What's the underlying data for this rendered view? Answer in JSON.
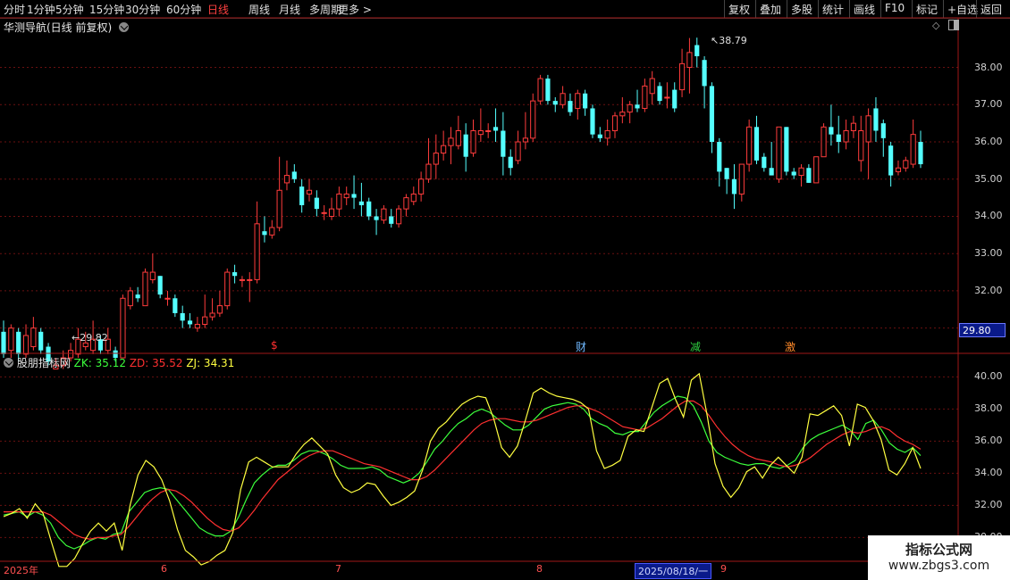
{
  "toolbar": {
    "periods": [
      "分时",
      "1分钟",
      "5分钟",
      "15分钟",
      "30分钟",
      "60分钟",
      "日线",
      "周线",
      "月线",
      "多周期",
      "更多 >"
    ],
    "active_period": "日线",
    "right_buttons": [
      "复权",
      "叠加",
      "多股",
      "统计",
      "画线",
      "F10",
      "标记",
      "+自选",
      "返回"
    ]
  },
  "main_panel": {
    "title": "华测导航(日线 前复权)",
    "max_label": "38.79",
    "min_label": "29.82",
    "current_price": "29.80",
    "y_ticks": [
      "38.00",
      "37.00",
      "36.00",
      "35.00",
      "34.00",
      "33.00",
      "32.00",
      "31.00"
    ],
    "events": [
      {
        "label": "$",
        "color": "#ff3030"
      },
      {
        "label": "财",
        "color": "#6fb8ff"
      },
      {
        "label": "减",
        "color": "#2fd040"
      },
      {
        "label": "激",
        "color": "#ff8a2a"
      }
    ]
  },
  "indicator_panel": {
    "name": "股朋指标网",
    "zk_label": "ZK: 35.12",
    "zd_label": "ZD: 35.52",
    "zj_label": "ZJ: 34.31",
    "y_ticks": [
      "40.00",
      "38.00",
      "36.00",
      "34.00",
      "32.00",
      "30.00"
    ]
  },
  "date_axis": {
    "labels": [
      "2025年",
      "6",
      "7",
      "8",
      "2025/08/18/一",
      "9"
    ]
  },
  "watermark": {
    "line1": "指标公式网",
    "line2": "www.zbgs3.com"
  },
  "colors": {
    "up": "#ff3c3c",
    "down": "#54ffff",
    "zk": "#3cff3c",
    "zd": "#ff3030",
    "zj": "#ffff40",
    "grid": "#6a1010",
    "border": "#a01818"
  },
  "chart_data": [
    {
      "type": "candlestick",
      "title": "华测导航(日线 前复权)",
      "y_axis_ticks": [
        31,
        32,
        33,
        34,
        35,
        36,
        37,
        38
      ],
      "ylim": [
        30.8,
        38.9
      ],
      "annotations": {
        "high": 38.79,
        "low": 29.82
      },
      "candles": [
        [
          30.9,
          30.3,
          31.2,
          30.2
        ],
        [
          30.4,
          31.0,
          31.1,
          30.2
        ],
        [
          30.9,
          30.3,
          31.0,
          30.1
        ],
        [
          30.3,
          30.8,
          31.1,
          30.2
        ],
        [
          30.5,
          31.0,
          31.3,
          30.4
        ],
        [
          30.9,
          30.4,
          31.0,
          30.3
        ],
        [
          30.5,
          30.1,
          30.6,
          30.0
        ],
        [
          29.9,
          30.0,
          30.2,
          29.9
        ],
        [
          30.0,
          30.2,
          30.4,
          29.9
        ],
        [
          30.2,
          30.4,
          30.6,
          30.1
        ],
        [
          30.3,
          30.7,
          31.0,
          30.2
        ],
        [
          30.5,
          30.6,
          30.9,
          30.4
        ],
        [
          30.4,
          30.7,
          31.2,
          30.3
        ],
        [
          30.7,
          30.4,
          30.8,
          30.3
        ],
        [
          30.4,
          30.7,
          31.0,
          30.3
        ],
        [
          30.4,
          30.2,
          30.5,
          30.1
        ],
        [
          30.2,
          31.8,
          31.9,
          30.2
        ],
        [
          31.6,
          32.0,
          32.1,
          31.5
        ],
        [
          31.9,
          31.8,
          32.1,
          31.7
        ],
        [
          31.6,
          32.5,
          32.6,
          31.6
        ],
        [
          32.3,
          32.5,
          33.0,
          32.2
        ],
        [
          32.4,
          31.9,
          32.4,
          31.8
        ],
        [
          31.8,
          31.8,
          32.0,
          31.6
        ],
        [
          31.8,
          31.4,
          31.9,
          31.3
        ],
        [
          31.4,
          31.2,
          31.6,
          31.0
        ],
        [
          31.2,
          31.1,
          31.4,
          31.0
        ],
        [
          31.0,
          31.1,
          31.3,
          30.9
        ],
        [
          31.1,
          31.3,
          31.9,
          31.0
        ],
        [
          31.3,
          31.4,
          31.8,
          31.2
        ],
        [
          31.4,
          31.6,
          32.0,
          31.3
        ],
        [
          31.6,
          32.5,
          32.6,
          31.5
        ],
        [
          32.5,
          32.4,
          32.7,
          32.2
        ],
        [
          32.3,
          32.3,
          32.4,
          32.1
        ],
        [
          32.3,
          32.3,
          32.5,
          31.7
        ],
        [
          32.3,
          33.8,
          34.4,
          32.2
        ],
        [
          33.6,
          33.5,
          34.0,
          33.3
        ],
        [
          33.5,
          33.7,
          33.9,
          33.4
        ],
        [
          33.7,
          34.7,
          35.6,
          33.6
        ],
        [
          34.9,
          35.1,
          35.5,
          34.7
        ],
        [
          35.2,
          35.0,
          35.4,
          34.9
        ],
        [
          34.8,
          34.3,
          35.0,
          34.1
        ],
        [
          34.6,
          34.7,
          35.0,
          34.4
        ],
        [
          34.5,
          34.2,
          34.7,
          34.0
        ],
        [
          34.1,
          34.1,
          34.3,
          33.9
        ],
        [
          34.0,
          34.2,
          34.5,
          33.9
        ],
        [
          34.2,
          34.6,
          34.8,
          34.0
        ],
        [
          34.5,
          34.6,
          34.8,
          34.3
        ],
        [
          34.6,
          34.5,
          35.1,
          34.2
        ],
        [
          34.4,
          34.3,
          34.9,
          34.0
        ],
        [
          34.4,
          34.0,
          34.5,
          33.9
        ],
        [
          34.0,
          33.9,
          34.2,
          33.5
        ],
        [
          33.9,
          34.2,
          34.3,
          33.8
        ],
        [
          34.0,
          33.8,
          34.2,
          33.7
        ],
        [
          33.8,
          34.2,
          34.3,
          33.7
        ],
        [
          34.2,
          34.5,
          34.6,
          34.0
        ],
        [
          34.4,
          34.6,
          34.8,
          34.3
        ],
        [
          34.6,
          35.0,
          35.2,
          34.4
        ],
        [
          35.0,
          35.4,
          36.1,
          34.9
        ],
        [
          35.4,
          35.7,
          36.2,
          35.0
        ],
        [
          35.7,
          35.9,
          36.3,
          35.5
        ],
        [
          35.9,
          36.1,
          36.4,
          35.4
        ],
        [
          35.9,
          36.3,
          36.7,
          35.8
        ],
        [
          36.2,
          35.6,
          36.5,
          35.2
        ],
        [
          35.7,
          36.3,
          36.6,
          35.6
        ],
        [
          36.2,
          36.3,
          36.9,
          36.0
        ],
        [
          36.3,
          36.3,
          36.5,
          36.1
        ],
        [
          36.4,
          36.3,
          36.9,
          36.0
        ],
        [
          36.3,
          35.6,
          36.8,
          35.1
        ],
        [
          35.6,
          35.3,
          35.8,
          35.1
        ],
        [
          35.5,
          36.0,
          36.3,
          35.4
        ],
        [
          36.0,
          36.1,
          36.8,
          35.8
        ],
        [
          36.1,
          37.1,
          37.3,
          36.0
        ],
        [
          37.1,
          37.7,
          37.8,
          37.0
        ],
        [
          37.7,
          37.1,
          37.8,
          37.0
        ],
        [
          37.1,
          37.0,
          37.2,
          36.8
        ],
        [
          37.0,
          37.3,
          37.5,
          36.9
        ],
        [
          37.1,
          36.8,
          37.3,
          36.7
        ],
        [
          36.9,
          37.3,
          37.4,
          36.6
        ],
        [
          37.3,
          36.9,
          37.4,
          36.7
        ],
        [
          36.9,
          36.2,
          37.0,
          36.1
        ],
        [
          36.2,
          36.1,
          36.4,
          36.0
        ],
        [
          36.1,
          36.3,
          36.6,
          35.9
        ],
        [
          36.3,
          36.7,
          36.8,
          36.1
        ],
        [
          36.7,
          36.8,
          37.2,
          36.5
        ],
        [
          36.8,
          37.0,
          37.1,
          36.5
        ],
        [
          37.0,
          36.9,
          37.4,
          36.8
        ],
        [
          36.9,
          37.5,
          37.7,
          36.8
        ],
        [
          37.3,
          37.7,
          37.9,
          37.0
        ],
        [
          37.5,
          37.1,
          37.6,
          37.0
        ],
        [
          37.2,
          37.2,
          37.6,
          36.9
        ],
        [
          37.4,
          36.9,
          37.6,
          36.8
        ],
        [
          37.4,
          38.1,
          38.5,
          37.2
        ],
        [
          38.0,
          38.4,
          38.79,
          37.3
        ],
        [
          38.6,
          38.3,
          38.8,
          38.0
        ],
        [
          38.2,
          37.5,
          38.3,
          36.9
        ],
        [
          37.5,
          36.0,
          37.6,
          35.7
        ],
        [
          36.0,
          35.2,
          36.1,
          34.8
        ],
        [
          35.3,
          35.0,
          35.3,
          34.6
        ],
        [
          35.0,
          34.6,
          35.4,
          34.2
        ],
        [
          34.6,
          35.4,
          35.4,
          34.4
        ],
        [
          35.4,
          36.4,
          36.6,
          35.2
        ],
        [
          36.4,
          35.5,
          36.7,
          35.4
        ],
        [
          35.6,
          35.3,
          35.7,
          35.2
        ],
        [
          35.3,
          35.1,
          36.0,
          35.1
        ],
        [
          35.0,
          36.4,
          36.4,
          34.9
        ],
        [
          36.4,
          35.2,
          36.4,
          35.1
        ],
        [
          35.2,
          35.1,
          35.3,
          35.0
        ],
        [
          35.1,
          35.3,
          35.4,
          34.8
        ],
        [
          35.3,
          34.9,
          35.4,
          34.9
        ],
        [
          34.9,
          35.6,
          35.6,
          34.9
        ],
        [
          35.6,
          36.4,
          36.5,
          35.6
        ],
        [
          36.4,
          36.2,
          37.0,
          35.9
        ],
        [
          36.2,
          36.0,
          36.7,
          35.7
        ],
        [
          36.0,
          36.3,
          36.6,
          35.8
        ],
        [
          36.3,
          36.5,
          36.7,
          36.1
        ],
        [
          35.5,
          36.3,
          36.7,
          35.2
        ],
        [
          36.0,
          36.7,
          36.9,
          35.0
        ],
        [
          36.9,
          36.3,
          37.2,
          36.0
        ],
        [
          36.5,
          36.1,
          36.6,
          35.6
        ],
        [
          35.9,
          35.1,
          36.0,
          34.8
        ],
        [
          35.2,
          35.3,
          35.5,
          35.1
        ],
        [
          35.3,
          35.5,
          35.6,
          35.2
        ],
        [
          35.4,
          36.2,
          36.6,
          35.3
        ],
        [
          36.0,
          35.4,
          36.3,
          35.3
        ]
      ]
    },
    {
      "type": "line",
      "title": "股朋指标网",
      "y_axis_ticks": [
        30,
        32,
        34,
        36,
        38,
        40
      ],
      "ylim": [
        28.8,
        40.8
      ],
      "series": [
        {
          "name": "ZK",
          "color": "#3cff3c",
          "values": [
            31.4,
            31.5,
            31.6,
            31.3,
            31.6,
            31.4,
            30.9,
            30.0,
            29.5,
            29.3,
            29.5,
            29.8,
            30.0,
            29.9,
            30.2,
            30.3,
            31.6,
            32.2,
            32.8,
            33.0,
            33.1,
            33.0,
            32.4,
            31.8,
            31.2,
            30.6,
            30.3,
            30.1,
            30.1,
            30.4,
            31.3,
            32.4,
            33.4,
            33.9,
            34.3,
            34.5,
            34.5,
            34.8,
            35.2,
            35.4,
            35.4,
            35.2,
            34.9,
            34.5,
            34.3,
            34.3,
            34.3,
            34.4,
            34.2,
            33.8,
            33.6,
            33.4,
            33.6,
            34.0,
            34.7,
            35.5,
            36.0,
            36.6,
            37.1,
            37.4,
            37.8,
            38.0,
            37.8,
            37.4,
            37.0,
            36.7,
            36.7,
            37.0,
            37.5,
            38.0,
            38.2,
            38.3,
            38.4,
            38.3,
            38.0,
            37.4,
            37.1,
            36.9,
            36.5,
            36.4,
            36.6,
            36.6,
            37.2,
            37.8,
            38.2,
            38.5,
            38.8,
            38.7,
            38.2,
            37.2,
            36.0,
            35.3,
            35.0,
            34.8,
            34.6,
            34.5,
            34.6,
            34.6,
            34.4,
            34.3,
            34.5,
            34.8,
            35.6,
            36.1,
            36.4,
            36.6,
            36.8,
            37.0,
            36.7,
            36.1,
            37.1,
            37.3,
            36.7,
            35.9,
            35.5,
            35.3,
            35.6,
            35.1
          ]
        },
        {
          "name": "ZD",
          "color": "#ff3030",
          "values": [
            31.6,
            31.6,
            31.6,
            31.6,
            31.6,
            31.6,
            31.4,
            31.0,
            30.6,
            30.2,
            30.0,
            29.9,
            30.0,
            30.0,
            30.1,
            30.2,
            30.7,
            31.3,
            31.9,
            32.4,
            32.8,
            33.0,
            32.9,
            32.6,
            32.2,
            31.7,
            31.2,
            30.8,
            30.5,
            30.4,
            30.6,
            31.1,
            31.7,
            32.4,
            33.0,
            33.6,
            34.0,
            34.4,
            34.8,
            35.1,
            35.3,
            35.4,
            35.4,
            35.2,
            35.0,
            34.8,
            34.6,
            34.5,
            34.4,
            34.2,
            34.0,
            33.8,
            33.6,
            33.6,
            33.8,
            34.2,
            34.7,
            35.2,
            35.7,
            36.2,
            36.7,
            37.1,
            37.3,
            37.4,
            37.4,
            37.3,
            37.2,
            37.2,
            37.3,
            37.5,
            37.7,
            37.9,
            38.1,
            38.2,
            38.2,
            38.0,
            37.8,
            37.5,
            37.2,
            36.9,
            36.8,
            36.7,
            36.8,
            37.1,
            37.4,
            37.8,
            38.2,
            38.5,
            38.5,
            38.2,
            37.6,
            36.9,
            36.3,
            35.8,
            35.4,
            35.1,
            34.9,
            34.8,
            34.7,
            34.5,
            34.4,
            34.5,
            34.7,
            35.0,
            35.4,
            35.8,
            36.1,
            36.4,
            36.6,
            36.5,
            36.6,
            36.8,
            36.9,
            36.7,
            36.3,
            36.0,
            35.8,
            35.5
          ]
        },
        {
          "name": "ZJ",
          "color": "#ffff40",
          "values": [
            31.3,
            31.5,
            31.8,
            31.2,
            32.1,
            31.5,
            29.8,
            28.2,
            28.2,
            28.7,
            29.6,
            30.4,
            30.9,
            30.4,
            30.9,
            29.2,
            32.0,
            33.9,
            34.8,
            34.4,
            33.6,
            32.3,
            30.5,
            29.2,
            28.8,
            28.3,
            28.5,
            28.9,
            29.2,
            30.3,
            33.0,
            34.7,
            35.0,
            34.7,
            34.4,
            34.4,
            34.4,
            35.2,
            35.8,
            36.2,
            35.7,
            35.2,
            33.9,
            33.1,
            32.8,
            33.0,
            33.4,
            33.3,
            32.6,
            32.0,
            32.2,
            32.5,
            32.9,
            34.2,
            36.0,
            36.8,
            37.2,
            37.8,
            38.3,
            38.6,
            38.8,
            38.7,
            37.4,
            35.6,
            35.0,
            35.7,
            37.3,
            39.0,
            39.3,
            39.0,
            38.8,
            38.7,
            38.6,
            38.4,
            38.0,
            35.4,
            34.3,
            34.5,
            34.8,
            36.3,
            36.7,
            36.6,
            38.1,
            39.6,
            39.9,
            38.6,
            37.5,
            39.8,
            40.2,
            37.6,
            34.6,
            33.2,
            32.5,
            33.1,
            34.1,
            34.4,
            33.7,
            34.5,
            35.0,
            34.5,
            34.0,
            35.0,
            37.7,
            37.6,
            37.9,
            38.2,
            37.6,
            35.7,
            38.3,
            38.1,
            37.3,
            36.1,
            34.2,
            33.9,
            34.6,
            35.6,
            34.3
          ]
        }
      ]
    }
  ]
}
